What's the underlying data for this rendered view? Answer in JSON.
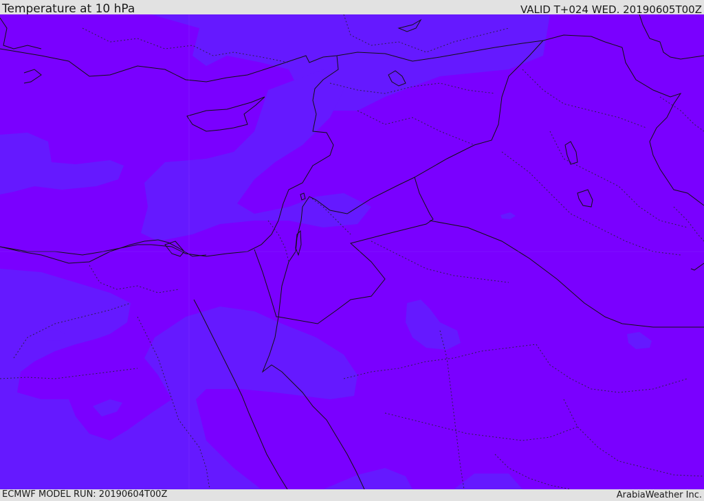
{
  "header": {
    "title": "Temperature at 10 hPa",
    "valid": "VALID T+024 WED. 20190605T00Z"
  },
  "footer": {
    "model_run": "ECMWF MODEL RUN: 20190604T00Z",
    "credit": "ArabiaWeather Inc."
  },
  "map": {
    "colors": {
      "warm_field": "#7a00ff",
      "cool_field": "#6519ff",
      "border": "#111111",
      "admin_border": "#2a1f4a"
    }
  }
}
